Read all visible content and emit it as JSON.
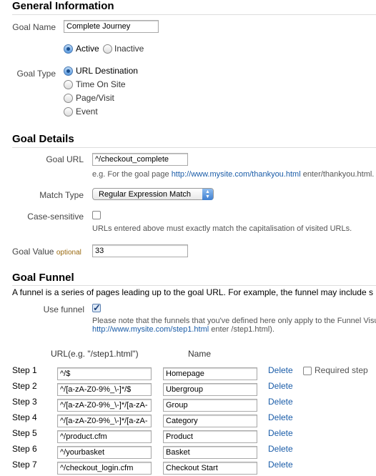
{
  "general": {
    "title": "General Information",
    "goal_name_label": "Goal Name",
    "goal_name_value": "Complete Journey",
    "active_label": "Active",
    "inactive_label": "Inactive",
    "active_selected": true,
    "goal_type_label": "Goal Type",
    "goal_types": [
      "URL Destination",
      "Time On Site",
      "Page/Visit",
      "Event"
    ],
    "selected_goal_type": "URL Destination"
  },
  "details": {
    "title": "Goal Details",
    "goal_url_label": "Goal URL",
    "goal_url_value": "^/checkout_complete",
    "goal_url_hint_prefix": "e.g. For the goal page ",
    "goal_url_hint_link": "http://www.mysite.com/thankyou.html",
    "goal_url_hint_suffix": " enter/thankyou.html. T",
    "match_type_label": "Match Type",
    "match_type_value": "Regular Expression Match",
    "case_label": "Case-sensitive",
    "case_checked": false,
    "case_hint": "URLs entered above must exactly match the capitalisation of visited URLs.",
    "goal_value_label": "Goal Value",
    "optional_label": "optional",
    "goal_value": "33"
  },
  "funnel": {
    "title": "Goal Funnel",
    "intro": "A funnel is a series of pages leading up to the goal URL. For example, the funnel may include s",
    "use_funnel_label": "Use funnel",
    "use_funnel_checked": true,
    "note_line1": "Please note that the funnels that you've defined here only apply to the Funnel Visua",
    "note_link": "http://www.mysite.com/step1.html",
    "note_line2_suffix": " enter /step1.html).",
    "url_header": "URL(e.g. \"/step1.html\")",
    "name_header": "Name",
    "delete_label": "Delete",
    "required_step_label": "Required step",
    "required_step_checked": false,
    "steps": [
      {
        "label": "Step 1",
        "url": "^/$",
        "name": "Homepage"
      },
      {
        "label": "Step 2",
        "url": "^/[a-zA-Z0-9%_\\-]*/$",
        "name": "Ubergroup"
      },
      {
        "label": "Step 3",
        "url": "^/[a-zA-Z0-9%_\\-]*/[a-zA-",
        "name": "Group"
      },
      {
        "label": "Step 4",
        "url": "^/[a-zA-Z0-9%_\\-]*/[a-zA-",
        "name": "Category"
      },
      {
        "label": "Step 5",
        "url": "^/product.cfm",
        "name": "Product"
      },
      {
        "label": "Step 6",
        "url": "^/yourbasket",
        "name": "Basket"
      },
      {
        "label": "Step 7",
        "url": "^/checkout_login.cfm",
        "name": "Checkout Start"
      }
    ]
  }
}
